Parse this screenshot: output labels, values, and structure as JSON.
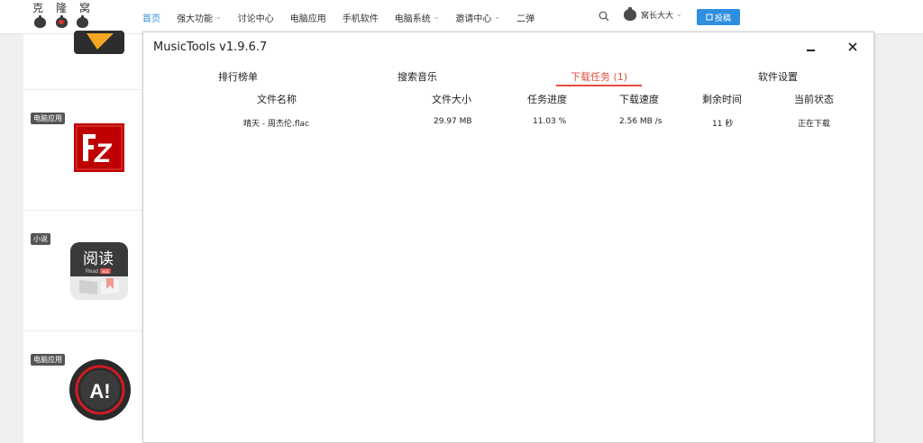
{
  "site": {
    "logo_chars": [
      "克",
      "隆",
      "窝"
    ]
  },
  "nav": {
    "items": [
      {
        "label": "首页",
        "active": true,
        "dropdown": false
      },
      {
        "label": "强大功能",
        "active": false,
        "dropdown": true
      },
      {
        "label": "讨论中心",
        "active": false,
        "dropdown": false
      },
      {
        "label": "电脑应用",
        "active": false,
        "dropdown": false
      },
      {
        "label": "手机软件",
        "active": false,
        "dropdown": false
      },
      {
        "label": "电脑系统",
        "active": false,
        "dropdown": true
      },
      {
        "label": "邀请中心",
        "active": false,
        "dropdown": true
      },
      {
        "label": "二弹",
        "active": false,
        "dropdown": false
      }
    ],
    "chevron_glyph": "⌄",
    "user_name": "窝长大大",
    "submit_label": "投稿",
    "accent_color": "#2e8ee0"
  },
  "sidebar": {
    "items": [
      {
        "badge": "",
        "icon": "play-app-icon"
      },
      {
        "badge": "电脑应用",
        "icon": "filezilla-icon",
        "icon_text": "Z"
      },
      {
        "badge": "小说",
        "icon": "reader-app-icon",
        "icon_text": "阅读",
        "icon_sub": "Read",
        "icon_tag": "阅读"
      },
      {
        "badge": "电脑应用",
        "icon": "red-ring-app-icon",
        "icon_text": "A!"
      }
    ]
  },
  "dialog": {
    "title": "MusicTools v1.9.6.7",
    "tabs": [
      {
        "label": "排行榜单",
        "active": false
      },
      {
        "label": "搜索音乐",
        "active": false
      },
      {
        "label": "下载任务 (1)",
        "active": true
      },
      {
        "label": "软件设置",
        "active": false
      }
    ],
    "columns": [
      "文件名称",
      "文件大小",
      "任务进度",
      "下载速度",
      "剩余时间",
      "当前状态"
    ],
    "rows": [
      {
        "name": "晴天 - 周杰伦.flac",
        "size": "29.97 MB",
        "progress": "11.03 %",
        "speed": "2.56 MB /s",
        "remaining": "11 秒",
        "status": "正在下载"
      }
    ],
    "active_color": "#e84c3d"
  }
}
